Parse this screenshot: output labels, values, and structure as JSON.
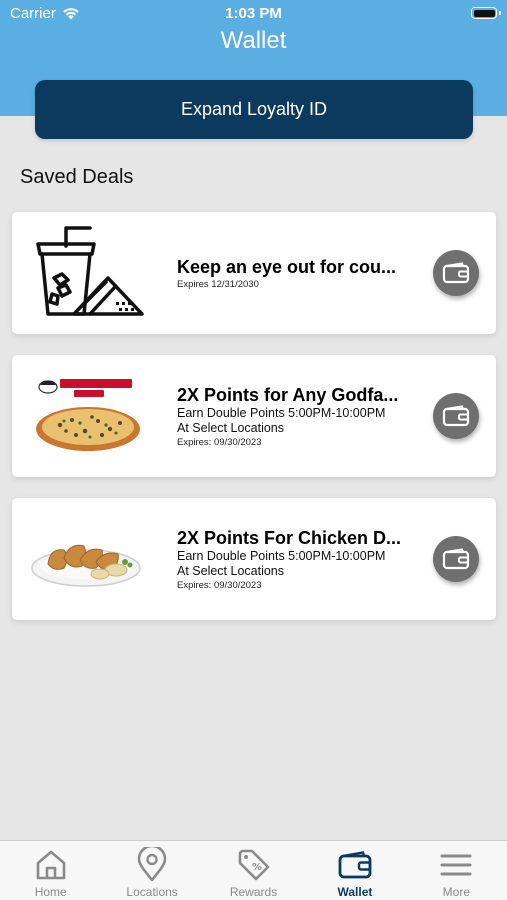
{
  "status_bar": {
    "carrier": "Carrier",
    "time": "1:03 PM"
  },
  "header": {
    "title": "Wallet",
    "loyalty_button_label": "Expand Loyalty ID"
  },
  "section_title": "Saved Deals",
  "deals": [
    {
      "title": "Keep an eye out for cou...",
      "description": "",
      "expires": "Expires 12/31/2030",
      "image_icon": "drink-and-chips-icon"
    },
    {
      "title": "2X Points for Any Godfa...",
      "description": "Earn Double Points 5:00PM-10:00PM\nAt Select Locations",
      "description_line1": "Earn Double Points 5:00PM-10:00PM",
      "description_line2": "At Select Locations",
      "expires": "Expires: 09/30/2023",
      "image_icon": "godfathers-pizza-image",
      "logo_text": "Godfather's Pizza"
    },
    {
      "title": "2X Points For Chicken D...",
      "description_line1": "Earn Double Points 5:00PM-10:00PM",
      "description_line2": "At Select Locations",
      "expires": "Expires: 09/30/2023",
      "image_icon": "chicken-plate-image"
    }
  ],
  "tabs": [
    {
      "label": "Home",
      "icon": "home-icon",
      "active": false
    },
    {
      "label": "Locations",
      "icon": "location-pin-icon",
      "active": false
    },
    {
      "label": "Rewards",
      "icon": "tag-percent-icon",
      "active": false
    },
    {
      "label": "Wallet",
      "icon": "wallet-icon",
      "active": true
    },
    {
      "label": "More",
      "icon": "menu-icon",
      "active": false
    }
  ],
  "colors": {
    "header_blue": "#5aaee2",
    "navy": "#0c3a5e",
    "wallet_button_gray": "#6f6f6f",
    "background": "#e6e6e6"
  }
}
